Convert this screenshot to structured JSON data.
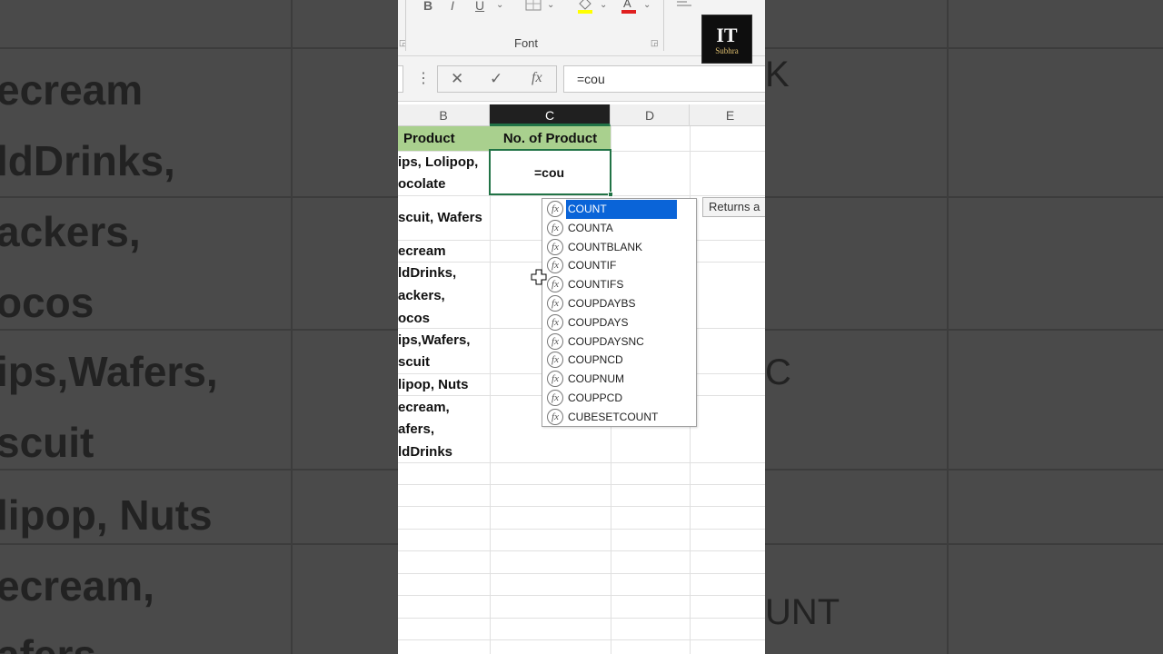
{
  "background": {
    "left_texts": [
      "ecream",
      "ldDrinks,",
      "ackers,",
      "ocos",
      "ips,Wafers,",
      "scuit",
      "lipop, Nuts",
      "ecream,",
      "afers"
    ],
    "right_texts": [
      "K",
      "C",
      "UNT"
    ]
  },
  "ribbon": {
    "bold": "B",
    "italic": "I",
    "underline": "U",
    "font_group_label": "Font"
  },
  "logo": {
    "main": "IT",
    "sub": "Subhra"
  },
  "formula_bar": {
    "cancel_icon": "✕",
    "enter_icon": "✓",
    "fx_icon": "fx",
    "value": "=cou"
  },
  "columns": [
    "B",
    "C",
    "D",
    "E"
  ],
  "active_column": "C",
  "sheet": {
    "header_b": "Product",
    "header_c": "No. of Product",
    "rows": [
      {
        "lines": [
          "ips, Lolipop,",
          "ocolate"
        ]
      },
      {
        "lines": [
          "scuit, Wafers"
        ]
      },
      {
        "lines": [
          "ecream",
          "ldDrinks,",
          "ackers,",
          "ocos"
        ]
      },
      {
        "lines": [
          "ips,Wafers,",
          "scuit"
        ]
      },
      {
        "lines": [
          "lipop, Nuts"
        ]
      },
      {
        "lines": [
          "ecream,",
          "afers,",
          "ldDrinks"
        ]
      }
    ],
    "active_cell_value": "=cou"
  },
  "autocomplete": {
    "items": [
      "COUNT",
      "COUNTA",
      "COUNTBLANK",
      "COUNTIF",
      "COUNTIFS",
      "COUPDAYBS",
      "COUPDAYS",
      "COUPDAYSNC",
      "COUPNCD",
      "COUPNUM",
      "COUPPCD",
      "CUBESETCOUNT"
    ],
    "selected": "COUNT",
    "icon_label": "fx"
  },
  "tooltip": {
    "text": "Returns a"
  },
  "colors": {
    "excel_green": "#217346",
    "header_fill": "#a9d08e",
    "selection_blue": "#0a64d8"
  }
}
